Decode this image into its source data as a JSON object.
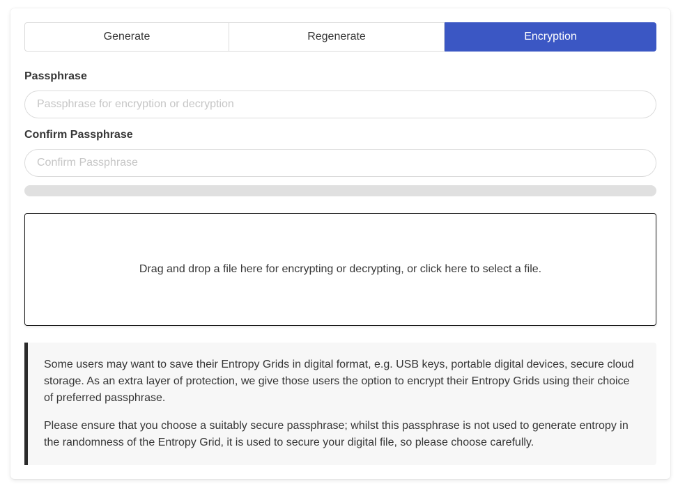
{
  "tabs": [
    {
      "label": "Generate",
      "active": false
    },
    {
      "label": "Regenerate",
      "active": false
    },
    {
      "label": "Encryption",
      "active": true
    }
  ],
  "colors": {
    "accent": "#3b57c4",
    "progress_track": "#e0e0e0",
    "notice_background": "#f7f7f7",
    "notice_border": "#2b2b2b"
  },
  "passphrase": {
    "label": "Passphrase",
    "placeholder": "Passphrase for encryption or decryption",
    "value": ""
  },
  "confirm_passphrase": {
    "label": "Confirm Passphrase",
    "placeholder": "Confirm Passphrase",
    "value": ""
  },
  "strength": {
    "progress": 0
  },
  "dropzone": {
    "text": "Drag and drop a file here for encrypting or decrypting, or click here to select a file."
  },
  "notice": {
    "paragraphs": [
      "Some users may want to save their Entropy Grids in digital format, e.g. USB keys, portable digital devices, secure cloud storage. As an extra layer of protection, we give those users the option to encrypt their Entropy Grids using their choice of preferred passphrase.",
      "Please ensure that you choose a suitably secure passphrase; whilst this passphrase is not used to generate entropy in the randomness of the Entropy Grid, it is used to secure your digital file, so please choose carefully."
    ]
  }
}
